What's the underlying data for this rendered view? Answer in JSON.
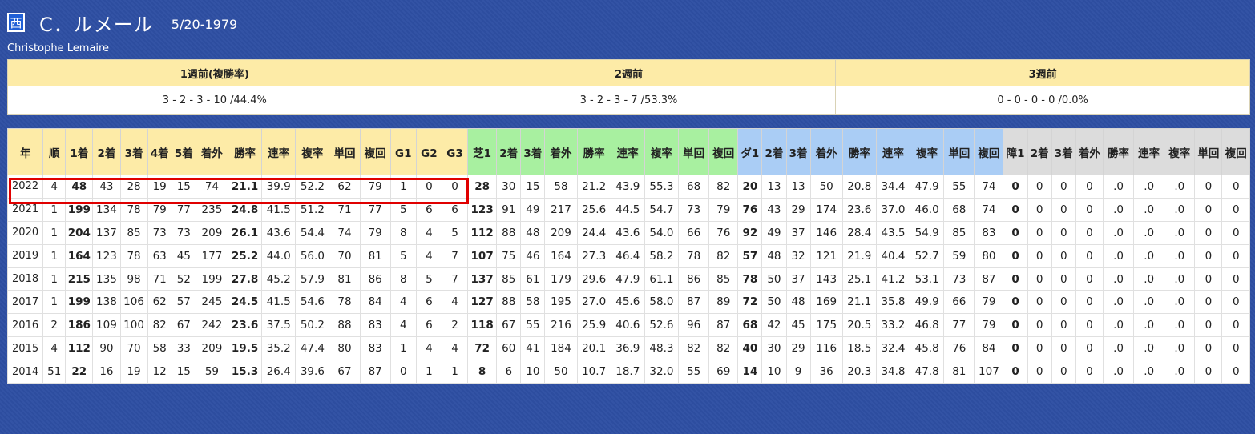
{
  "profile": {
    "region_badge": "西",
    "name_ja": "C．ルメール",
    "birth_date": "5/20-1979",
    "name_en": "Christophe Lemaire"
  },
  "recent_weeks": [
    {
      "label": "1週前(複勝率)",
      "value": "3 - 2 - 3 - 10 /44.4%"
    },
    {
      "label": "2週前",
      "value": "3 - 2 - 3 - 7 /53.3%"
    },
    {
      "label": "3週前",
      "value": "0 - 0 - 0 - 0 /0.0%"
    }
  ],
  "stats_table": {
    "columns": [
      {
        "label": "年",
        "group": "base"
      },
      {
        "label": "順",
        "group": "base"
      },
      {
        "label": "1着",
        "group": "base"
      },
      {
        "label": "2着",
        "group": "base"
      },
      {
        "label": "3着",
        "group": "base"
      },
      {
        "label": "4着",
        "group": "base"
      },
      {
        "label": "5着",
        "group": "base"
      },
      {
        "label": "着外",
        "group": "base"
      },
      {
        "label": "勝率",
        "group": "base"
      },
      {
        "label": "連率",
        "group": "base"
      },
      {
        "label": "複率",
        "group": "base"
      },
      {
        "label": "単回",
        "group": "base"
      },
      {
        "label": "複回",
        "group": "base"
      },
      {
        "label": "G1",
        "group": "base"
      },
      {
        "label": "G2",
        "group": "base"
      },
      {
        "label": "G3",
        "group": "base"
      },
      {
        "label": "芝1",
        "group": "turf"
      },
      {
        "label": "2着",
        "group": "turf"
      },
      {
        "label": "3着",
        "group": "turf"
      },
      {
        "label": "着外",
        "group": "turf"
      },
      {
        "label": "勝率",
        "group": "turf"
      },
      {
        "label": "連率",
        "group": "turf"
      },
      {
        "label": "複率",
        "group": "turf"
      },
      {
        "label": "単回",
        "group": "turf"
      },
      {
        "label": "複回",
        "group": "turf"
      },
      {
        "label": "ダ1",
        "group": "dirt"
      },
      {
        "label": "2着",
        "group": "dirt"
      },
      {
        "label": "3着",
        "group": "dirt"
      },
      {
        "label": "着外",
        "group": "dirt"
      },
      {
        "label": "勝率",
        "group": "dirt"
      },
      {
        "label": "連率",
        "group": "dirt"
      },
      {
        "label": "複率",
        "group": "dirt"
      },
      {
        "label": "単回",
        "group": "dirt"
      },
      {
        "label": "複回",
        "group": "dirt"
      },
      {
        "label": "障1",
        "group": "jump"
      },
      {
        "label": "2着",
        "group": "jump"
      },
      {
        "label": "3着",
        "group": "jump"
      },
      {
        "label": "着外",
        "group": "jump"
      },
      {
        "label": "勝率",
        "group": "jump"
      },
      {
        "label": "連率",
        "group": "jump"
      },
      {
        "label": "複率",
        "group": "jump"
      },
      {
        "label": "単回",
        "group": "jump"
      },
      {
        "label": "複回",
        "group": "jump"
      }
    ],
    "rows": [
      [
        "2022",
        "4",
        "48",
        "43",
        "28",
        "19",
        "15",
        "74",
        "21.1",
        "39.9",
        "52.2",
        "62",
        "79",
        "1",
        "0",
        "0",
        "28",
        "30",
        "15",
        "58",
        "21.2",
        "43.9",
        "55.3",
        "68",
        "82",
        "20",
        "13",
        "13",
        "50",
        "20.8",
        "34.4",
        "47.9",
        "55",
        "74",
        "0",
        "0",
        "0",
        "0",
        ".0",
        ".0",
        ".0",
        "0",
        "0"
      ],
      [
        "2021",
        "1",
        "199",
        "134",
        "78",
        "79",
        "77",
        "235",
        "24.8",
        "41.5",
        "51.2",
        "71",
        "77",
        "5",
        "6",
        "6",
        "123",
        "91",
        "49",
        "217",
        "25.6",
        "44.5",
        "54.7",
        "73",
        "79",
        "76",
        "43",
        "29",
        "174",
        "23.6",
        "37.0",
        "46.0",
        "68",
        "74",
        "0",
        "0",
        "0",
        "0",
        ".0",
        ".0",
        ".0",
        "0",
        "0"
      ],
      [
        "2020",
        "1",
        "204",
        "137",
        "85",
        "73",
        "73",
        "209",
        "26.1",
        "43.6",
        "54.4",
        "74",
        "79",
        "8",
        "4",
        "5",
        "112",
        "88",
        "48",
        "209",
        "24.4",
        "43.6",
        "54.0",
        "66",
        "76",
        "92",
        "49",
        "37",
        "146",
        "28.4",
        "43.5",
        "54.9",
        "85",
        "83",
        "0",
        "0",
        "0",
        "0",
        ".0",
        ".0",
        ".0",
        "0",
        "0"
      ],
      [
        "2019",
        "1",
        "164",
        "123",
        "78",
        "63",
        "45",
        "177",
        "25.2",
        "44.0",
        "56.0",
        "70",
        "81",
        "5",
        "4",
        "7",
        "107",
        "75",
        "46",
        "164",
        "27.3",
        "46.4",
        "58.2",
        "78",
        "82",
        "57",
        "48",
        "32",
        "121",
        "21.9",
        "40.4",
        "52.7",
        "59",
        "80",
        "0",
        "0",
        "0",
        "0",
        ".0",
        ".0",
        ".0",
        "0",
        "0"
      ],
      [
        "2018",
        "1",
        "215",
        "135",
        "98",
        "71",
        "52",
        "199",
        "27.8",
        "45.2",
        "57.9",
        "81",
        "86",
        "8",
        "5",
        "7",
        "137",
        "85",
        "61",
        "179",
        "29.6",
        "47.9",
        "61.1",
        "86",
        "85",
        "78",
        "50",
        "37",
        "143",
        "25.1",
        "41.2",
        "53.1",
        "73",
        "87",
        "0",
        "0",
        "0",
        "0",
        ".0",
        ".0",
        ".0",
        "0",
        "0"
      ],
      [
        "2017",
        "1",
        "199",
        "138",
        "106",
        "62",
        "57",
        "245",
        "24.5",
        "41.5",
        "54.6",
        "78",
        "84",
        "4",
        "6",
        "4",
        "127",
        "88",
        "58",
        "195",
        "27.0",
        "45.6",
        "58.0",
        "87",
        "89",
        "72",
        "50",
        "48",
        "169",
        "21.1",
        "35.8",
        "49.9",
        "66",
        "79",
        "0",
        "0",
        "0",
        "0",
        ".0",
        ".0",
        ".0",
        "0",
        "0"
      ],
      [
        "2016",
        "2",
        "186",
        "109",
        "100",
        "82",
        "67",
        "242",
        "23.6",
        "37.5",
        "50.2",
        "88",
        "83",
        "4",
        "6",
        "2",
        "118",
        "67",
        "55",
        "216",
        "25.9",
        "40.6",
        "52.6",
        "96",
        "87",
        "68",
        "42",
        "45",
        "175",
        "20.5",
        "33.2",
        "46.8",
        "77",
        "79",
        "0",
        "0",
        "0",
        "0",
        ".0",
        ".0",
        ".0",
        "0",
        "0"
      ],
      [
        "2015",
        "4",
        "112",
        "90",
        "70",
        "58",
        "33",
        "209",
        "19.5",
        "35.2",
        "47.4",
        "80",
        "83",
        "1",
        "4",
        "4",
        "72",
        "60",
        "41",
        "184",
        "20.1",
        "36.9",
        "48.3",
        "82",
        "82",
        "40",
        "30",
        "29",
        "116",
        "18.5",
        "32.4",
        "45.8",
        "76",
        "84",
        "0",
        "0",
        "0",
        "0",
        ".0",
        ".0",
        ".0",
        "0",
        "0"
      ],
      [
        "2014",
        "51",
        "22",
        "16",
        "19",
        "12",
        "15",
        "59",
        "15.3",
        "26.4",
        "39.6",
        "67",
        "87",
        "0",
        "1",
        "1",
        "8",
        "6",
        "10",
        "50",
        "10.7",
        "18.7",
        "32.0",
        "55",
        "69",
        "14",
        "10",
        "9",
        "36",
        "20.3",
        "34.8",
        "47.8",
        "81",
        "107",
        "0",
        "0",
        "0",
        "0",
        ".0",
        ".0",
        ".0",
        "0",
        "0"
      ]
    ]
  }
}
